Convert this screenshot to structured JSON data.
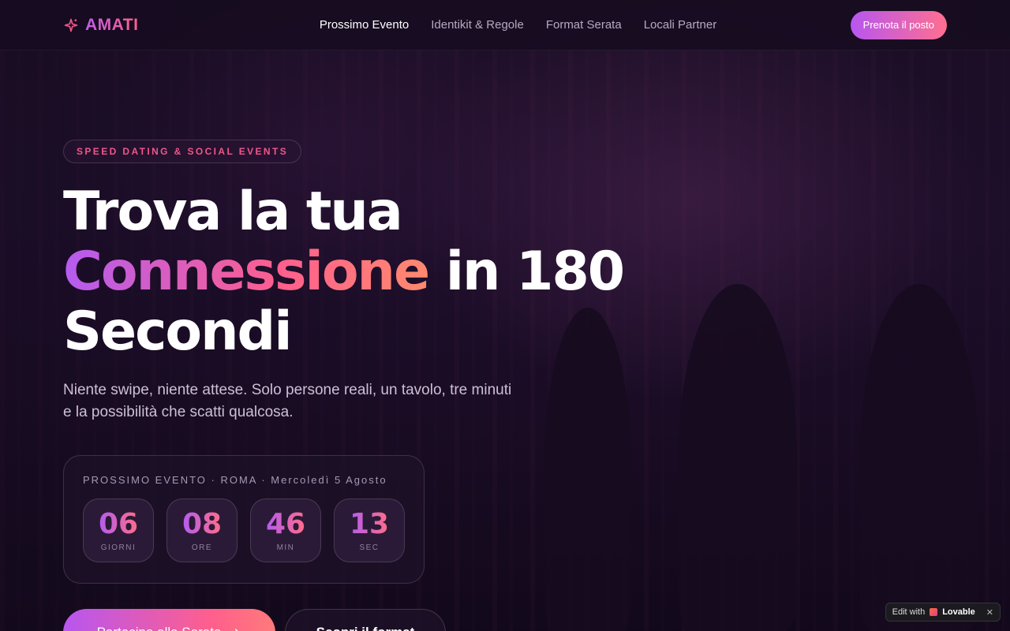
{
  "nav": {
    "brand": "AMATI",
    "links": [
      "Prossimo Evento",
      "Identikit & Regole",
      "Format Serata",
      "Locali Partner"
    ],
    "cta": "Prenota il posto"
  },
  "hero": {
    "badge": "SPEED DATING & SOCIAL EVENTS",
    "headline_line1": "Trova la tua",
    "headline_highlight": "Connessione",
    "headline_line2_rest": " in 180",
    "headline_line3": "Secondi",
    "subtitle": "Niente swipe, niente attese. Solo persone reali, un tavolo, tre minuti e la possibilità che scatti qualcosa."
  },
  "countdown": {
    "title": "PROSSIMO EVENTO · ROMA · Mercoledì 5 Agosto",
    "units": [
      {
        "value": "06",
        "label": "GIORNI"
      },
      {
        "value": "08",
        "label": "ORE"
      },
      {
        "value": "46",
        "label": "MIN"
      },
      {
        "value": "13",
        "label": "SEC"
      }
    ]
  },
  "ctas": {
    "primary": "Partecipa alla Serata",
    "secondary": "Scopri il format"
  },
  "lovable": {
    "prefix": "Edit with",
    "brand": "Lovable",
    "close": "✕"
  },
  "colors": {
    "accent_pink": "#ff5f8c",
    "accent_purple": "#b45cf0",
    "background": "#140a1e"
  }
}
